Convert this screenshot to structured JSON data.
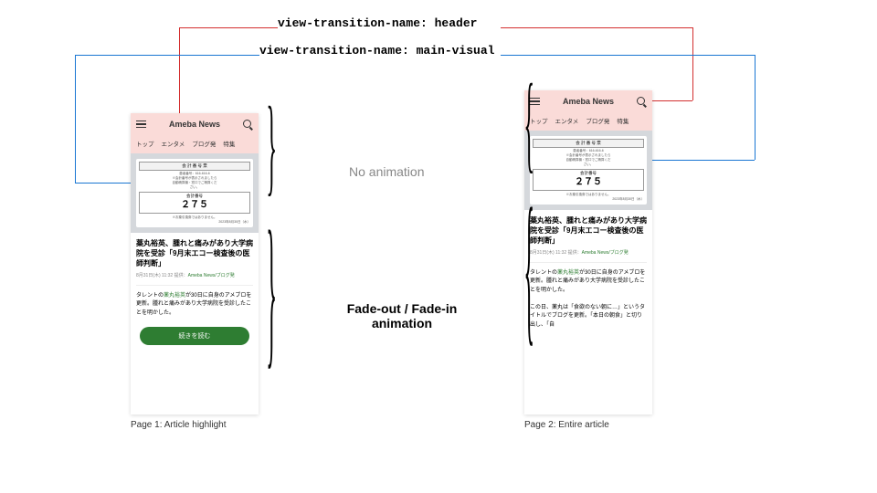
{
  "labels": {
    "header": "view-transition-name: header",
    "main_visual": "view-transition-name: main-visual"
  },
  "annotations": {
    "no_anim": "No animation",
    "fade": "Fade-out / Fade-in animation"
  },
  "captions": {
    "page1": "Page 1: Article highlight",
    "page2": "Page 2: Entire article"
  },
  "phone": {
    "logo": "Ameba News",
    "tabs": [
      "トップ",
      "エンタメ",
      "ブログ発",
      "特集"
    ],
    "ticket": {
      "title": "会 計 番 号 票",
      "sub1": "患者番号：616-616-6",
      "sub2": "※会計番号が表示されましたら\n自動精算機・窓口でご精算くだ\nさい。",
      "label": "会計番号",
      "number": "２７５",
      "note": "※お薬引換券ではありません。",
      "date": "2023年8月30日（水）"
    },
    "article_title": "薬丸裕英、腫れと痛みがあり大学病院を受診「9月末エコー検査後の医師判断」",
    "meta_date": "8月31日(木) 11:32",
    "meta_provider": "提供：",
    "meta_source": "Ameba News/ブログ発",
    "body_p1_a": "タレントの",
    "body_p1_link": "薬丸裕英",
    "body_p1_b": "が30日に自身のアメブロを更新。腫れと痛みがあり大学病院を受診したことを明かした。",
    "body_p2": "この日、薬丸は「食欲のない朝に…」というタイトルでブログを更新。「本日の朝食」と切り出し、「自",
    "btn": "続きを読む"
  }
}
